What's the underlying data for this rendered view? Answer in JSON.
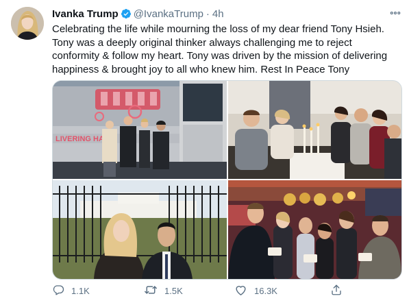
{
  "user": {
    "name": "Ivanka Trump",
    "handle": "@IvankaTrump",
    "separator": "·",
    "time": "4h",
    "verified": true
  },
  "tweet": {
    "text": "Celebrating the life while mourning the loss of my dear friend Tony Hsieh. Tony was a deeply original thinker always challenging me to reject conformity & follow my heart. Tony was driven by the mission of delivering happiness & brought joy to all who knew him. Rest In Peace Tony"
  },
  "media": {
    "photos": [
      {
        "id": "bus-photo",
        "bus_sign_text": "LIVERING HAPPI"
      },
      {
        "id": "dinner-photo"
      },
      {
        "id": "white-house-photo"
      },
      {
        "id": "casino-photo"
      }
    ]
  },
  "actions": {
    "reply_count": "1.1K",
    "retweet_count": "1.5K",
    "like_count": "16.3K"
  },
  "icons": {
    "verified": "verified-badge-icon",
    "more": "more-options-icon",
    "reply": "reply-icon",
    "retweet": "retweet-icon",
    "like": "heart-icon",
    "share": "share-icon"
  },
  "colors": {
    "text": "#0f1419",
    "secondary": "#5b7083",
    "verified": "#1da1f2",
    "border": "#cfd9de"
  }
}
